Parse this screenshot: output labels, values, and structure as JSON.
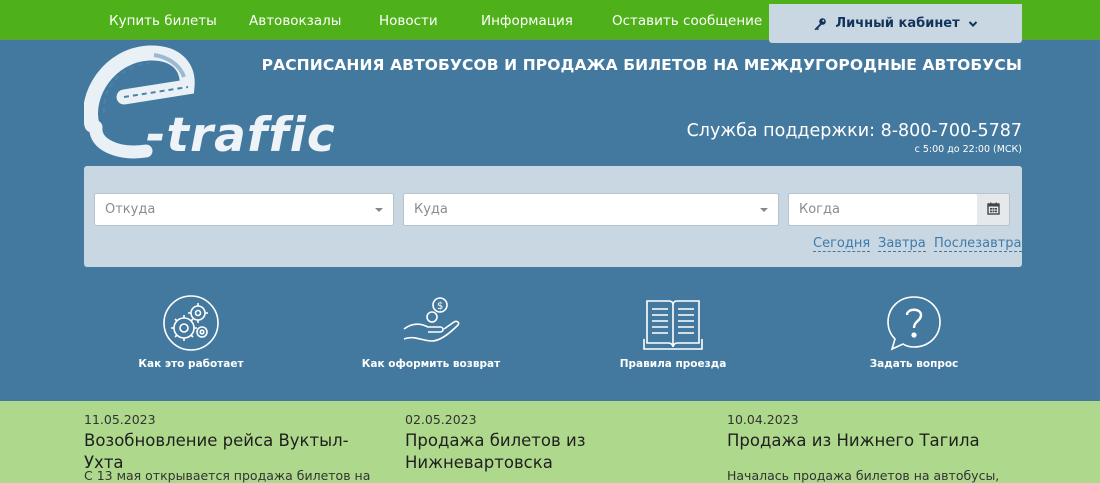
{
  "nav": {
    "items": [
      {
        "label": "Купить билеты"
      },
      {
        "label": "Автовокзалы"
      },
      {
        "label": "Новости"
      },
      {
        "label": "Информация"
      },
      {
        "label": "Оставить сообщение"
      }
    ],
    "cabinet_label": "Личный кабинет",
    "cabinet_icon": "key-icon",
    "cabinet_chevron": "chevron-down-icon"
  },
  "logo": {
    "text": "e-traffic"
  },
  "header": {
    "headline": "РАСПИСАНИЯ АВТОБУСОВ И ПРОДАЖА БИЛЕТОВ НА МЕЖДУГОРОДНЫЕ АВТОБУСЫ",
    "support": "Служба поддержки: 8-800-700-5787",
    "support_hours": "с 5:00 до 22:00 (МСК)"
  },
  "search": {
    "from_placeholder": "Откуда",
    "to_placeholder": "Куда",
    "date_placeholder": "Когда",
    "calendar_icon": "calendar-icon",
    "quick_days": [
      "Сегодня",
      "Завтра",
      "Послезавтра"
    ]
  },
  "features": [
    {
      "label": "Как это работает",
      "icon": "gears-icon"
    },
    {
      "label": "Как оформить возврат",
      "icon": "hand-coins-icon"
    },
    {
      "label": "Правила проезда",
      "icon": "book-icon"
    },
    {
      "label": "Задать вопрос",
      "icon": "question-icon"
    }
  ],
  "news": [
    {
      "date": "11.05.2023",
      "title": "Возобновление рейса Вуктыл-Ухта",
      "text": "С 13 мая открывается продажа билетов на"
    },
    {
      "date": "02.05.2023",
      "title": "Продажа билетов из Нижневартовска",
      "text": ""
    },
    {
      "date": "10.04.2023",
      "title": "Продажа из Нижнего Тагила",
      "text": "Началась продажа билетов на автобусы,"
    }
  ],
  "colors": {
    "nav_green": "#4fb11a",
    "header_blue": "#44799f",
    "panel_grey": "#c8d7e1",
    "news_green": "#aed98c",
    "link_blue": "#3e7bab"
  }
}
